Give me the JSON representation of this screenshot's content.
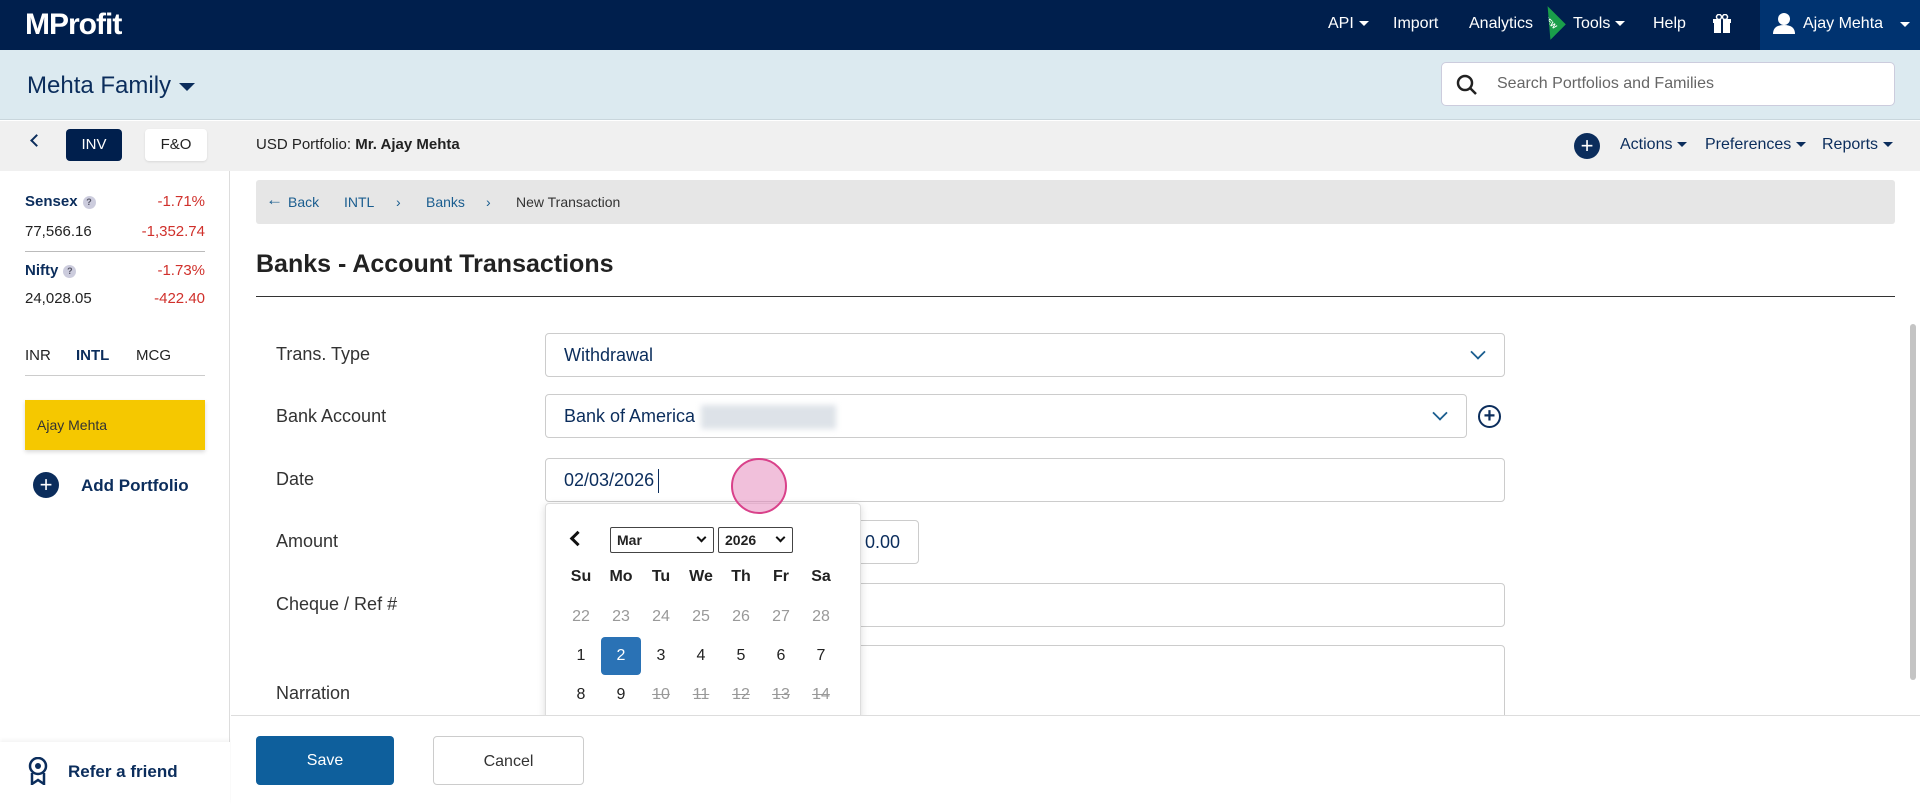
{
  "topbar": {
    "logo": "MProfit",
    "nav": [
      "API",
      "Import",
      "Analytics",
      "Tools",
      "Help"
    ],
    "new_badge": "NEW",
    "user": "Ajay Mehta"
  },
  "family": {
    "name": "Mehta Family"
  },
  "search": {
    "placeholder": "Search Portfolios and Families"
  },
  "tabs": {
    "inv": "INV",
    "fo": "F&O"
  },
  "portfolio": {
    "label": "USD Portfolio:",
    "name": "Mr. Ajay Mehta"
  },
  "menu": {
    "actions": "Actions",
    "preferences": "Preferences",
    "reports": "Reports"
  },
  "indices": [
    {
      "name": "Sensex",
      "pct": "-1.71%",
      "value": "77,566.16",
      "change": "-1,352.74"
    },
    {
      "name": "Nifty",
      "pct": "-1.73%",
      "value": "24,028.05",
      "change": "-422.40"
    }
  ],
  "help_glyph": "?",
  "region_tabs": [
    "INR",
    "INTL",
    "MCG"
  ],
  "sidebar": {
    "portfolio": "Ajay Mehta",
    "add": "Add Portfolio",
    "refer": "Refer a friend"
  },
  "breadcrumb": {
    "back": "Back",
    "items": [
      "INTL",
      "Banks",
      "New Transaction"
    ]
  },
  "page_title": "Banks - Account Transactions",
  "form": {
    "trans_type_label": "Trans. Type",
    "trans_type": "Withdrawal",
    "bank_label": "Bank Account",
    "bank": "Bank of America",
    "date_label": "Date",
    "date": "02/03/2026",
    "amount_label": "Amount",
    "amount": "0.00",
    "cheque_label": "Cheque / Ref #",
    "narration_label": "Narration"
  },
  "calendar": {
    "month": "Mar",
    "year": "2026",
    "weekdays": [
      "Su",
      "Mo",
      "Tu",
      "We",
      "Th",
      "Fr",
      "Sa"
    ],
    "rows": [
      [
        "22",
        "23",
        "24",
        "25",
        "26",
        "27",
        "28"
      ],
      [
        "1",
        "2",
        "3",
        "4",
        "5",
        "6",
        "7"
      ],
      [
        "8",
        "9",
        "10",
        "11",
        "12",
        "13",
        "14"
      ]
    ],
    "selected": "2"
  },
  "buttons": {
    "save": "Save",
    "cancel": "Cancel"
  },
  "colors": {
    "navy": "#001f4d",
    "accent": "#0e5f9c",
    "yellow": "#f5c800"
  }
}
